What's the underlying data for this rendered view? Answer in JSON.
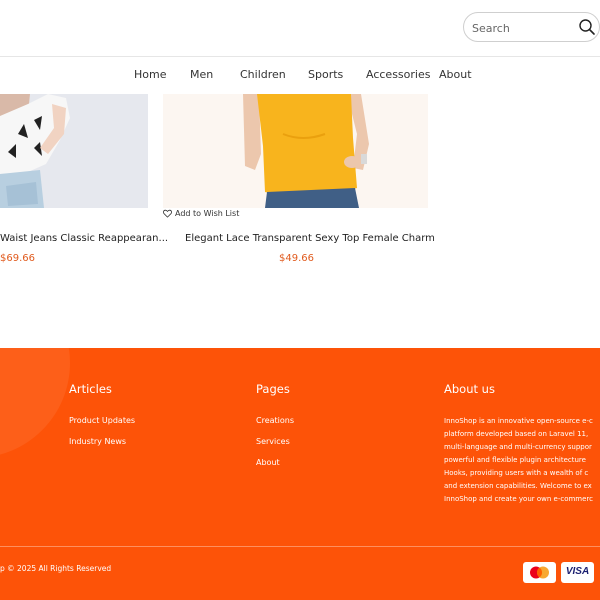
{
  "header": {
    "search": {
      "placeholder": "Search",
      "value": "",
      "icon": "search-icon"
    }
  },
  "nav": {
    "items": [
      {
        "label": "Home"
      },
      {
        "label": "Men"
      },
      {
        "label": "Children"
      },
      {
        "label": "Sports"
      },
      {
        "label": "Accessories"
      },
      {
        "label": "About"
      }
    ]
  },
  "products": [
    {
      "title": "Waist Jeans Classic Reappearan...",
      "price": "$69.66"
    },
    {
      "title": "Elegant Lace Transparent Sexy Top Female Charm",
      "price": "$49.66",
      "wishlist_label": "Add to Wish List",
      "wishlist_icon": "heart-icon"
    }
  ],
  "footer": {
    "bg_color": "#fd5308",
    "articles": {
      "title": "Articles",
      "links": [
        "Product Updates",
        "Industry News"
      ]
    },
    "pages": {
      "title": "Pages",
      "links": [
        "Creations",
        "Services",
        "About"
      ]
    },
    "about": {
      "title": "About us",
      "lines": [
        "InnoShop is an innovative open-source e-c",
        "platform developed based on Laravel 11,",
        "multi-language and multi-currency suppor",
        "powerful and flexible plugin architecture",
        "Hooks, providing users with a wealth of c",
        "and extension capabilities. Welcome to ex",
        "InnoShop and create your own e-commerc"
      ]
    },
    "copyright": "p © 2025 All Rights Reserved",
    "payments": [
      {
        "name": "mastercard-icon"
      },
      {
        "name": "visa-icon",
        "label": "VISA"
      }
    ]
  },
  "colors": {
    "accent": "#fd5308",
    "price": "#e05a1d"
  }
}
